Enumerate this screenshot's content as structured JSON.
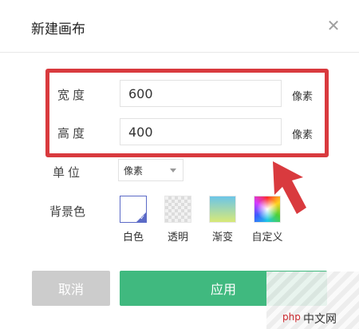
{
  "dialog": {
    "title": "新建画布",
    "close_glyph": "✕"
  },
  "size": {
    "width_label": "宽度",
    "width_value": "600",
    "width_unit": "像素",
    "height_label": "高度",
    "height_value": "400",
    "height_unit": "像素"
  },
  "unit": {
    "label": "单位",
    "selected": "像素"
  },
  "background": {
    "label": "背景色",
    "options": [
      {
        "label": "白色",
        "icon": "white-swatch-icon",
        "selected": true
      },
      {
        "label": "透明",
        "icon": "transparent-swatch-icon",
        "selected": false
      },
      {
        "label": "渐变",
        "icon": "gradient-swatch-icon",
        "selected": false
      },
      {
        "label": "自定义",
        "icon": "custom-color-icon",
        "selected": false
      }
    ]
  },
  "buttons": {
    "cancel": "取消",
    "apply": "应用"
  },
  "watermark": {
    "text_1": "php",
    "text_2": "中文网"
  },
  "colors": {
    "highlight": "#d93a3e",
    "apply": "#40b97f",
    "cancel": "#cccccc",
    "selected": "#5b6ac7"
  }
}
